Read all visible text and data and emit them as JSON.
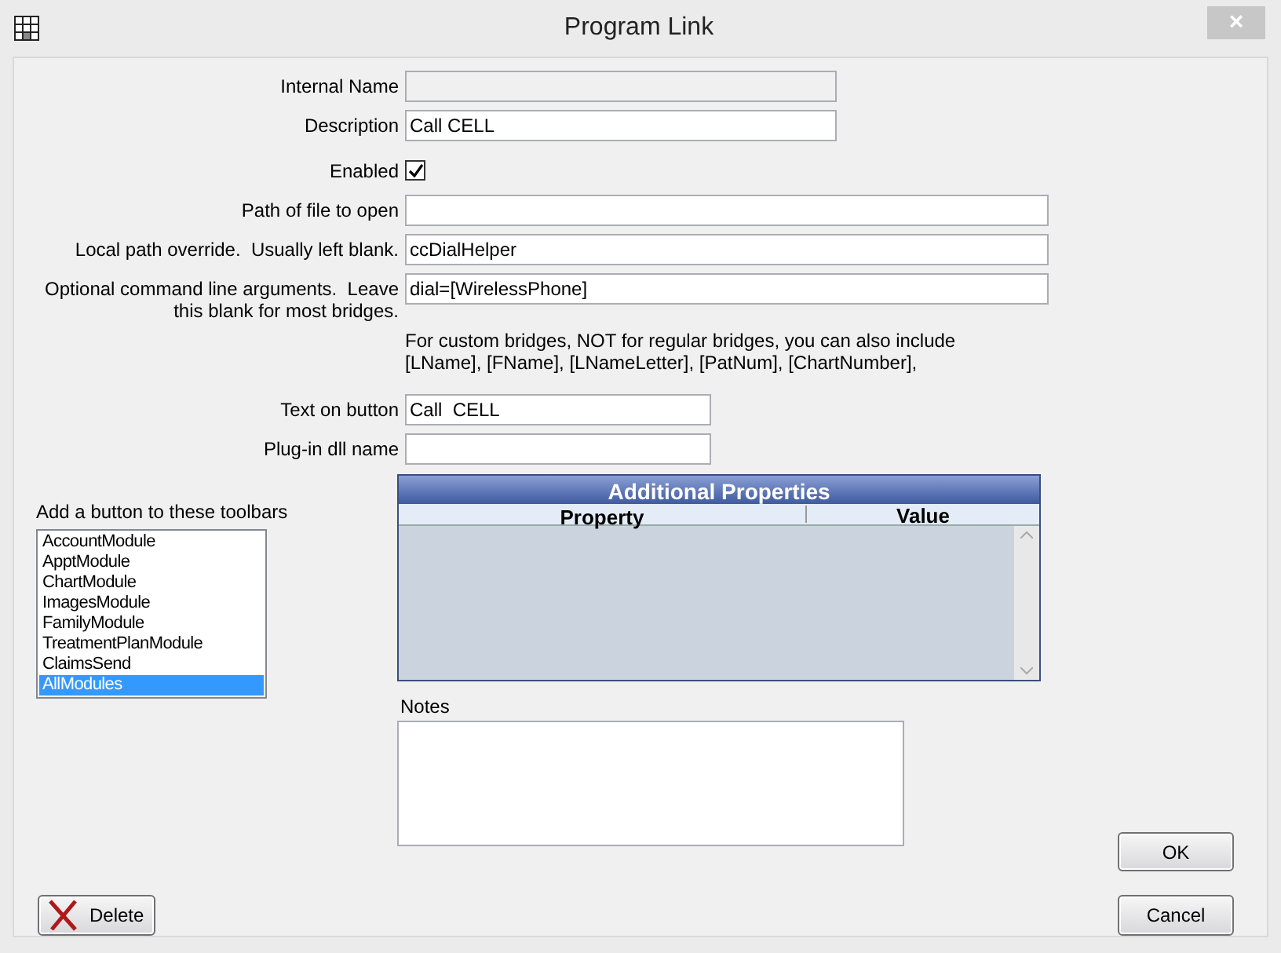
{
  "window": {
    "title": "Program Link",
    "close": "×"
  },
  "fields": [
    {
      "label": "Internal Name",
      "disabled": true
    },
    {
      "label": "Description",
      "value": "Call CELL",
      "disabled": false
    },
    {
      "label": "Enabled",
      "kind": "checkbox",
      "checked": true
    },
    {
      "label": "Path of file to open",
      "disabled": false
    },
    {
      "label": "Local path override.  Usually left blank.",
      "value": "ccDialHelper",
      "disabled": false
    },
    {
      "label": "Optional command line arguments.  Leave this blank for most bridges.",
      "value": "dial=[WirelessPhone]",
      "disabled": false
    }
  ],
  "help_text": "For custom bridges, NOT for regular bridges, you can also include [LName], [FName], [LNameLetter], [PatNum], [ChartNumber],",
  "fields_2": [
    {
      "label": "Text on button",
      "value": "Call  CELL",
      "disabled": false
    },
    {
      "label": "Plug-in dll name",
      "disabled": false
    }
  ],
  "toolbars": {
    "label": "Add a button to these toolbars",
    "items": [
      {
        "label": "AccountModule",
        "selected": false
      },
      {
        "label": "ApptModule",
        "selected": false
      },
      {
        "label": "ChartModule",
        "selected": false
      },
      {
        "label": "ImagesModule",
        "selected": false
      },
      {
        "label": "FamilyModule",
        "selected": false
      },
      {
        "label": "TreatmentPlanModule",
        "selected": false
      },
      {
        "label": "ClaimsSend",
        "selected": false
      },
      {
        "label": "AllModules",
        "selected": true
      }
    ]
  },
  "grid": {
    "title": "Additional Properties",
    "columns": [
      "Property",
      "Value"
    ]
  },
  "notes": {
    "label": "Notes"
  },
  "buttons": {
    "ok": "OK",
    "cancel": "Cancel",
    "delete": "Delete"
  }
}
